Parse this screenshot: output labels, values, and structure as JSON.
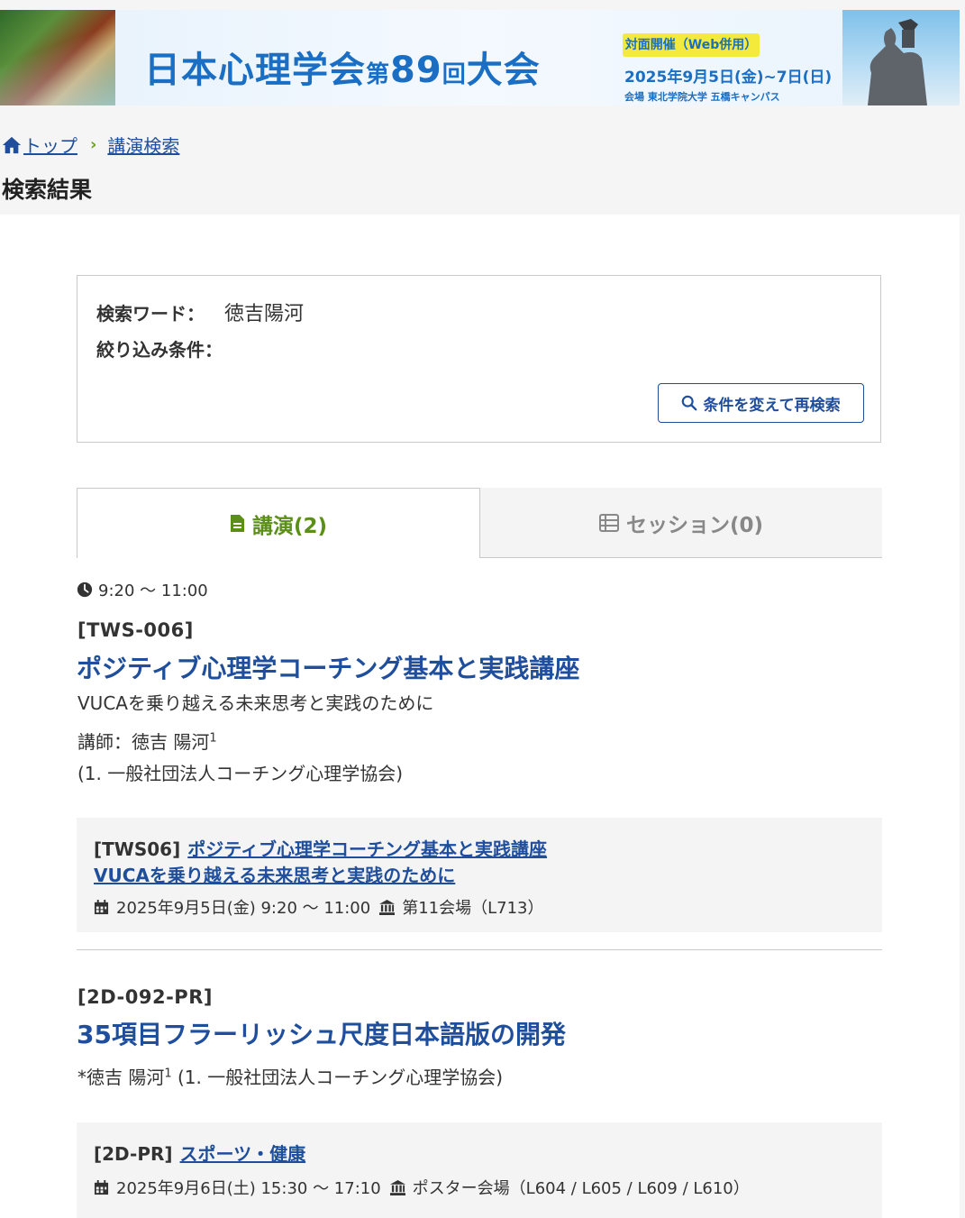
{
  "banner": {
    "title_main": "日本心理学会",
    "title_small": "第",
    "title_number": "89",
    "title_small2": "回",
    "title_end": "大会",
    "badge": "対面開催（Web併用）",
    "date": "2025年9月5日(金)~7日(日)",
    "venue": "会場 東北学院大学 五橋キャンパス"
  },
  "breadcrumb": {
    "home": "トップ",
    "current": "講演検索"
  },
  "page_title": "検索結果",
  "search": {
    "keyword_label": "検索ワード：",
    "keyword_value": "徳吉陽河",
    "filter_label": "絞り込み条件：",
    "research_button": "条件を変えて再検索"
  },
  "tabs": [
    {
      "label": "講演(2)",
      "active": true
    },
    {
      "label": "セッション(0)",
      "active": false
    }
  ],
  "results": [
    {
      "time": "9:20 〜 11:00",
      "code": "[TWS-006]",
      "title": "ポジティブ心理学コーチング基本と実践講座",
      "subtitle": "VUCAを乗り越える未来思考と実践のために",
      "lecturer": "講師：徳吉 陽河",
      "lecturer_sup": "1",
      "affiliation": "(1. 一般社団法人コーチング心理学協会)",
      "session": {
        "code": "[TWS06]",
        "title_line1": "ポジティブ心理学コーチング基本と実践講座",
        "title_line2": "VUCAを乗り越える未来思考と実践のために",
        "date": "2025年9月5日(金) 9:20 〜 11:00",
        "room": "第11会場（L713）"
      }
    },
    {
      "code": "[2D-092-PR]",
      "title": "35項目フラーリッシュ尺度日本語版の開発",
      "author": "*徳吉 陽河",
      "author_sup": "1",
      "affiliation": " (1. 一般社団法人コーチング心理学協会)",
      "session": {
        "code": "[2D-PR]",
        "title_line1": "スポーツ・健康",
        "date": "2025年9月6日(土) 15:30 〜 17:10",
        "room": "ポスター会場（L604 / L605 / L609 / L610）"
      }
    }
  ],
  "colors": {
    "link": "#1f4e9c",
    "accent_green": "#5b8f1a",
    "banner_blue": "#1a6fc4",
    "badge_yellow": "#f3ea3c"
  }
}
